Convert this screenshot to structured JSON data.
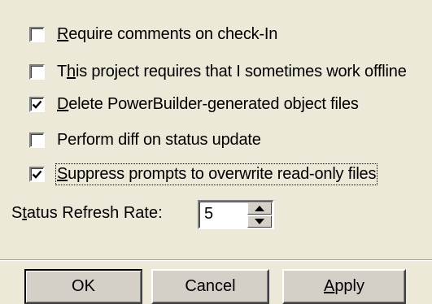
{
  "options": [
    {
      "label": "Require comments on check-In",
      "mnemonic": "R",
      "rest": "equire comments on check-In",
      "checked": false
    },
    {
      "label": "This project requires that I sometimes work offline",
      "pre": "T",
      "mnemonic": "h",
      "rest": "is project requires that I sometimes work offline",
      "checked": false
    },
    {
      "label": "Delete PowerBuilder-generated object files",
      "mnemonic": "D",
      "rest": "elete PowerBuilder-generated object files",
      "checked": true
    },
    {
      "label": "Perform diff on status update",
      "checked": false
    },
    {
      "label": "Suppress prompts to overwrite read-only files",
      "mnemonic": "S",
      "rest": "uppress prompts to overwrite read-only files",
      "checked": true
    }
  ],
  "status_refresh": {
    "label_pre": "S",
    "label_mnemonic": "t",
    "label_rest": "atus Refresh Rate:",
    "value": "5"
  },
  "buttons": {
    "ok": "OK",
    "cancel": "Cancel",
    "apply_mnemonic": "A",
    "apply_rest": "pply"
  },
  "icons": {
    "checkmark": "checkmark-icon",
    "spin_up": "arrow-up-icon",
    "spin_down": "arrow-down-icon"
  },
  "colors": {
    "dialog_bg": "#ece9d8",
    "field_bg": "#ffffff"
  }
}
